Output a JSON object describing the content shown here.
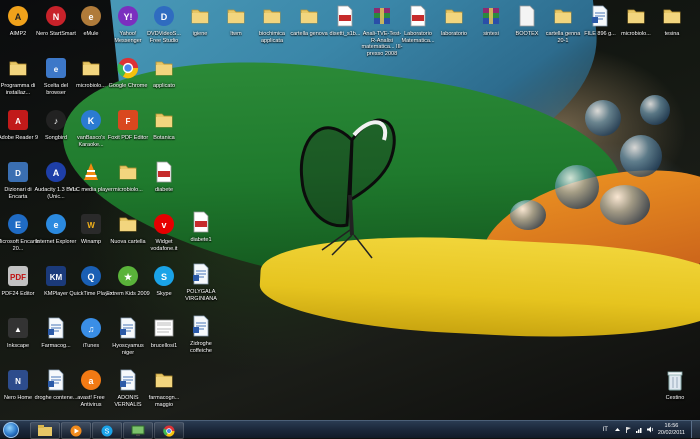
{
  "desktop": {
    "col1": [
      {
        "label": "AIMP2",
        "icon": "aimp-icon"
      },
      {
        "label": "Programma di installaz...",
        "icon": "folder-icon"
      },
      {
        "label": "Adobe Reader 9",
        "icon": "adobe-reader-icon"
      },
      {
        "label": "Dizionari di Encarta",
        "icon": "encarta-dictionary-icon"
      },
      {
        "label": "Microsoft Encarta 20...",
        "icon": "encarta-icon"
      },
      {
        "label": "PDF24 Editor",
        "icon": "pdf24-icon"
      },
      {
        "label": "Inkscape",
        "icon": "inkscape-icon"
      },
      {
        "label": "Nero Home",
        "icon": "nero-home-icon"
      }
    ],
    "col2": [
      {
        "label": "Nero StartSmart",
        "icon": "nero-startsmart-icon"
      },
      {
        "label": "Scelta del browser",
        "icon": "browser-choice-icon"
      },
      {
        "label": "Songbird",
        "icon": "songbird-icon"
      },
      {
        "label": "Audacity 1.3 Beta (Unic...",
        "icon": "audacity-icon"
      },
      {
        "label": "Internet Explorer",
        "icon": "internet-explorer-icon"
      },
      {
        "label": "KMPlayer",
        "icon": "kmplayer-icon"
      },
      {
        "label": "Farmacog...",
        "icon": "document-icon"
      },
      {
        "label": "droghe contene...",
        "icon": "document-icon"
      }
    ],
    "col3": [
      {
        "label": "eMule",
        "icon": "emule-icon"
      },
      {
        "label": "microbiolo...",
        "icon": "folder-icon"
      },
      {
        "label": "vanBasco's Karaoke...",
        "icon": "vanbasco-icon"
      },
      {
        "label": "VLC media player",
        "icon": "vlc-icon"
      },
      {
        "label": "Winamp",
        "icon": "winamp-icon"
      },
      {
        "label": "QuickTime Player",
        "icon": "quicktime-icon"
      },
      {
        "label": "iTunes",
        "icon": "itunes-icon"
      },
      {
        "label": "avast! Free Antivirus",
        "icon": "avast-icon"
      }
    ],
    "col4": [
      {
        "label": "Yahoo! Messenger",
        "icon": "yahoo-messenger-icon"
      },
      {
        "label": "Google Chrome",
        "icon": "chrome-icon"
      },
      {
        "label": "Foxit PDF Editor",
        "icon": "foxit-icon"
      },
      {
        "label": "microbiolo...",
        "icon": "folder-icon"
      },
      {
        "label": "Nuova cartella",
        "icon": "folder-icon"
      },
      {
        "label": "Extrem Kids 2009",
        "icon": "game-icon"
      },
      {
        "label": "Hyoscyamus niger",
        "icon": "document-icon"
      },
      {
        "label": "ADONIS VERNALIS",
        "icon": "document-icon"
      }
    ],
    "col5": [
      {
        "label": "DVDVideoS... Free Studio",
        "icon": "dvdvideosoft-icon"
      },
      {
        "label": "applicato",
        "icon": "folder-icon"
      },
      {
        "label": "Botanica",
        "icon": "folder-icon"
      },
      {
        "label": "diabete",
        "icon": "pdf-icon"
      },
      {
        "label": "Widget vodafone.it",
        "icon": "vodafone-icon"
      },
      {
        "label": "Skype",
        "icon": "skype-icon"
      },
      {
        "label": "brucellosi1",
        "icon": "image-icon"
      },
      {
        "label": "farmacogn... maggio",
        "icon": "folder-icon"
      }
    ],
    "col6": [
      {
        "label": "diabete1",
        "icon": "pdf-icon"
      },
      {
        "label": "POLYGALA VIRGINIANA",
        "icon": "document-icon"
      },
      {
        "label": "Zidroghe coffeiche",
        "icon": "document-icon"
      }
    ],
    "toprow": [
      {
        "label": "igiene",
        "icon": "folder-icon"
      },
      {
        "label": "ltwm",
        "icon": "folder-icon"
      },
      {
        "label": "biochimica applicata",
        "icon": "folder-icon"
      },
      {
        "label": "cartella genova",
        "icon": "folder-icon"
      },
      {
        "label": "disetti_s1b...",
        "icon": "pdf-icon"
      },
      {
        "label": "Anali-TVE-Test-R-Analisi matematica... III-presso 2008",
        "icon": "winrar-icon"
      },
      {
        "label": "Laboratorio Matematica...",
        "icon": "pdf-icon"
      },
      {
        "label": "laboratorio",
        "icon": "folder-icon"
      },
      {
        "label": "sintesi",
        "icon": "winrar-icon"
      },
      {
        "label": "BOOTEX",
        "icon": "file-icon"
      },
      {
        "label": "cartella genna 20-1",
        "icon": "folder-icon"
      },
      {
        "label": "FILE 896 g...",
        "icon": "document-icon"
      },
      {
        "label": "microbiolo...",
        "icon": "folder-icon"
      },
      {
        "label": "tesina",
        "icon": "folder-icon"
      }
    ],
    "recycle": {
      "label": "Cestino",
      "icon": "recycle-bin-icon"
    }
  },
  "taskbar": {
    "pinned": [
      "windows-explorer-icon",
      "media-player-icon",
      "skype-icon",
      "network-icon",
      "chrome-icon"
    ],
    "language": "IT",
    "time": "16:56",
    "date": "20/02/2011"
  },
  "colors": {
    "taskbar": "#1a2638",
    "folder": "#e7c766",
    "accent": "#2a76c8"
  }
}
